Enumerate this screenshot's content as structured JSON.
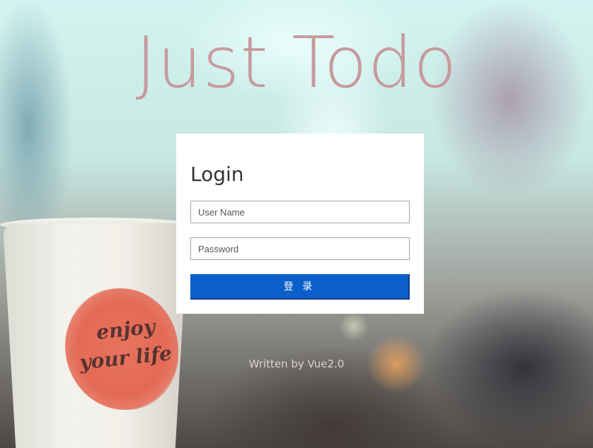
{
  "app": {
    "title": "Just Todo"
  },
  "login": {
    "heading": "Login",
    "username_placeholder": "User Name",
    "username_value": "",
    "password_placeholder": "Password",
    "password_value": "",
    "submit_label": "登 录"
  },
  "footer": {
    "text": "Written by Vue2.0"
  },
  "background": {
    "cup_text_line1": "enjoy",
    "cup_text_line2": "your life"
  },
  "colors": {
    "title": "#c79a9c",
    "button": "#0b5fca",
    "card": "#ffffff",
    "footer_text": "#d8d2cf"
  }
}
